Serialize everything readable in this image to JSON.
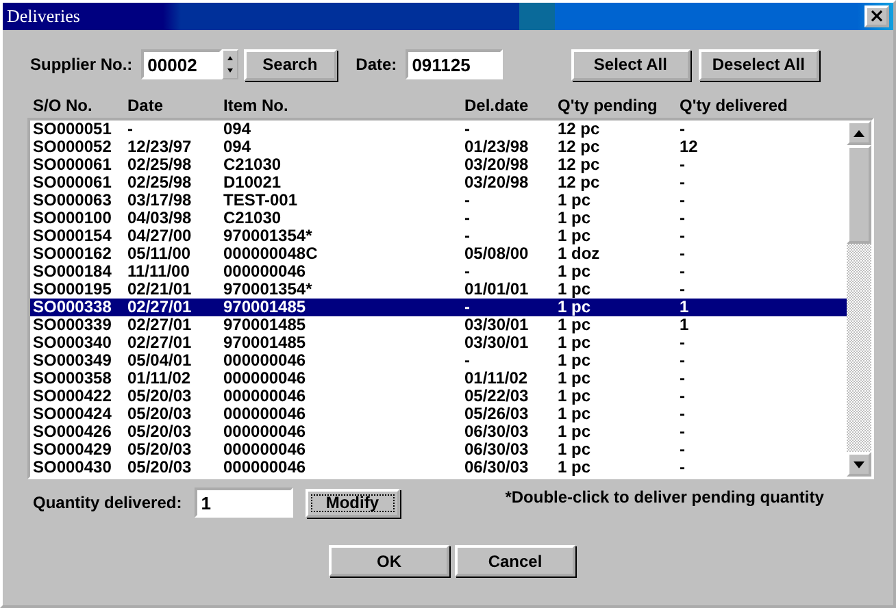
{
  "window": {
    "title": "Deliveries",
    "close": "×"
  },
  "supplier": {
    "label": "Supplier No.:",
    "value": "00002"
  },
  "search_button": "Search",
  "date": {
    "label": "Date:",
    "value": "091125"
  },
  "select_all_button": "Select All",
  "deselect_all_button": "Deselect All",
  "columns": [
    "S/O No.",
    "Date",
    "Item No.",
    "Del.date",
    "Q'ty pending",
    "Q'ty delivered"
  ],
  "rows": [
    {
      "cells": [
        "SO000051",
        "-",
        "094",
        "-",
        "12 pc",
        "-"
      ],
      "selected": false
    },
    {
      "cells": [
        "SO000052",
        "12/23/97",
        "094",
        "01/23/98",
        "12 pc",
        "12"
      ],
      "selected": false
    },
    {
      "cells": [
        "SO000061",
        "02/25/98",
        "C21030",
        "03/20/98",
        "12 pc",
        "-"
      ],
      "selected": false
    },
    {
      "cells": [
        "SO000061",
        "02/25/98",
        "D10021",
        "03/20/98",
        "12 pc",
        "-"
      ],
      "selected": false
    },
    {
      "cells": [
        "SO000063",
        "03/17/98",
        "TEST-001",
        "-",
        "1 pc",
        "-"
      ],
      "selected": false
    },
    {
      "cells": [
        "SO000100",
        "04/03/98",
        "C21030",
        "-",
        "1 pc",
        "-"
      ],
      "selected": false
    },
    {
      "cells": [
        "SO000154",
        "04/27/00",
        "970001354*",
        "-",
        "1 pc",
        "-"
      ],
      "selected": false
    },
    {
      "cells": [
        "SO000162",
        "05/11/00",
        "000000048C",
        "05/08/00",
        "1 doz",
        "-"
      ],
      "selected": false
    },
    {
      "cells": [
        "SO000184",
        "11/11/00",
        "000000046",
        "-",
        "1 pc",
        "-"
      ],
      "selected": false
    },
    {
      "cells": [
        "SO000195",
        "02/21/01",
        "970001354*",
        "01/01/01",
        "1 pc",
        "-"
      ],
      "selected": false
    },
    {
      "cells": [
        "SO000338",
        "02/27/01",
        "970001485",
        "-",
        "1 pc",
        "1"
      ],
      "selected": true
    },
    {
      "cells": [
        "SO000339",
        "02/27/01",
        "970001485",
        "03/30/01",
        "1 pc",
        "1"
      ],
      "selected": false
    },
    {
      "cells": [
        "SO000340",
        "02/27/01",
        "970001485",
        "03/30/01",
        "1 pc",
        "-"
      ],
      "selected": false
    },
    {
      "cells": [
        "SO000349",
        "05/04/01",
        "000000046",
        "-",
        "1 pc",
        "-"
      ],
      "selected": false
    },
    {
      "cells": [
        "SO000358",
        "01/11/02",
        "000000046",
        "01/11/02",
        "1 pc",
        "-"
      ],
      "selected": false
    },
    {
      "cells": [
        "SO000422",
        "05/20/03",
        "000000046",
        "05/22/03",
        "1 pc",
        "-"
      ],
      "selected": false
    },
    {
      "cells": [
        "SO000424",
        "05/20/03",
        "000000046",
        "05/26/03",
        "1 pc",
        "-"
      ],
      "selected": false
    },
    {
      "cells": [
        "SO000426",
        "05/20/03",
        "000000046",
        "06/30/03",
        "1 pc",
        "-"
      ],
      "selected": false
    },
    {
      "cells": [
        "SO000429",
        "05/20/03",
        "000000046",
        "06/30/03",
        "1 pc",
        "-"
      ],
      "selected": false
    },
    {
      "cells": [
        "SO000430",
        "05/20/03",
        "000000046",
        "06/30/03",
        "1 pc",
        "-"
      ],
      "selected": false
    }
  ],
  "quantity": {
    "label": "Quantity delivered:",
    "value": "1"
  },
  "modify_button": "Modify",
  "hint": "*Double-click to deliver pending quantity",
  "buttons": [
    "OK",
    "Cancel"
  ]
}
